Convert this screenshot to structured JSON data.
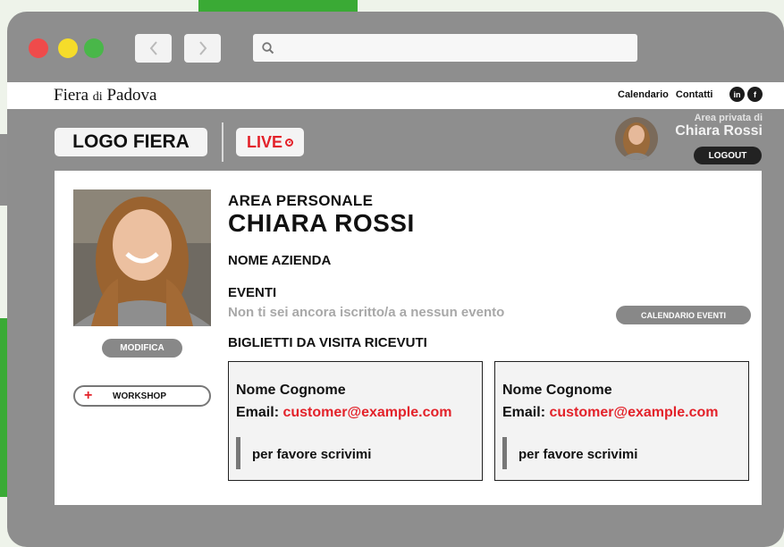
{
  "browser": {
    "back_icon": "chevron-left-icon",
    "forward_icon": "chevron-right-icon",
    "search_icon": "search-icon",
    "url_value": ""
  },
  "site": {
    "brand_main": "Fiera",
    "brand_small": "di",
    "brand_end": "Padova",
    "nav": [
      "Calendario",
      "Contatti"
    ],
    "social": {
      "linkedin": "in",
      "facebook": "f"
    }
  },
  "header": {
    "logo_text": "LOGO FIERA",
    "live_label": "LIVE",
    "private_area_label": "Area privata di",
    "private_area_user": "Chiara Rossi",
    "logout_label": "LOGOUT"
  },
  "profile": {
    "section_title": "AREA PERSONALE",
    "name": "CHIARA ROSSI",
    "company": "NOME AZIENDA",
    "edit_label": "MODIFICA",
    "workshop_label": "WORKSHOP"
  },
  "events": {
    "title": "EVENTI",
    "empty_message": "Non ti sei ancora iscritto/a a nessun evento",
    "calendar_button": "CALENDARIO EVENTI"
  },
  "business_cards": {
    "title": "BIGLIETTI DA VISITA RICEVUTI",
    "cards": [
      {
        "name": "Nome Cognome",
        "email_label": "Email:",
        "email": "customer@example.com",
        "note": "per favore scrivimi"
      },
      {
        "name": "Nome Cognome",
        "email_label": "Email:",
        "email": "customer@example.com",
        "note": "per favore scrivimi"
      }
    ]
  },
  "colors": {
    "accent_red": "#e3222a",
    "brand_green": "#3aaa35",
    "frame_gray": "#8e8e8e"
  }
}
